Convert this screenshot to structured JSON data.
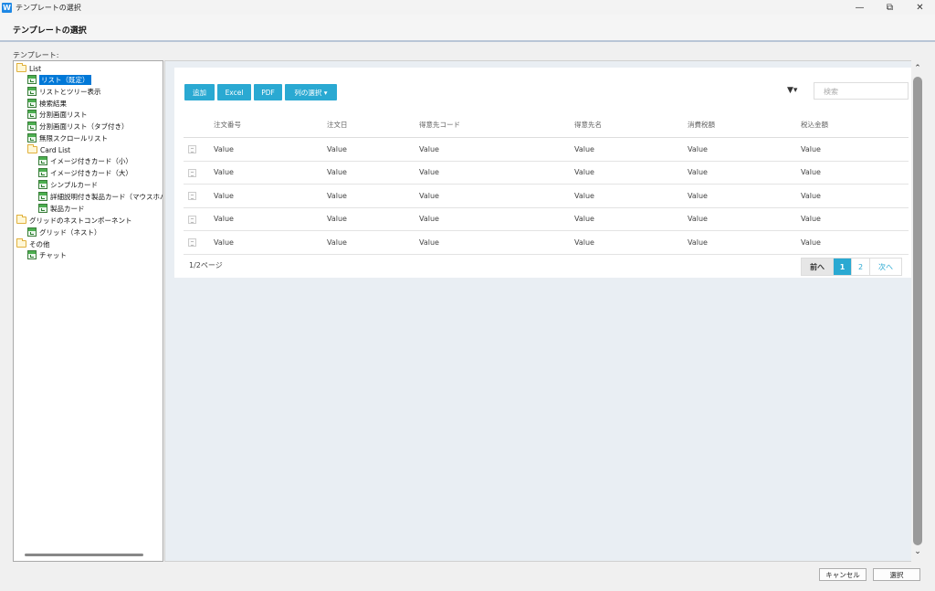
{
  "window": {
    "title": "テンプレートの選択",
    "app_icon": "W",
    "controls": [
      "—",
      "⧉",
      "✕"
    ]
  },
  "header": {
    "title": "テンプレートの選択"
  },
  "template_label": "テンプレート:",
  "tree": {
    "items": [
      {
        "label": "List",
        "type": "folder"
      },
      {
        "label": "リスト（既定）",
        "type": "page",
        "selected": true
      },
      {
        "label": "リストとツリー表示",
        "type": "page"
      },
      {
        "label": "検索結果",
        "type": "page"
      },
      {
        "label": "分割画面リスト",
        "type": "page"
      },
      {
        "label": "分割画面リスト（タブ付き）",
        "type": "page"
      },
      {
        "label": "無限スクロールリスト",
        "type": "page"
      },
      {
        "label": "Card List",
        "type": "folder"
      },
      {
        "label": "イメージ付きカード（小）",
        "type": "page"
      },
      {
        "label": "イメージ付きカード（大）",
        "type": "page"
      },
      {
        "label": "シンプルカード",
        "type": "page"
      },
      {
        "label": "詳細説明付き製品カード（マウスホバー",
        "type": "page"
      },
      {
        "label": "製品カード",
        "type": "page"
      },
      {
        "label": "グリッドのネストコンポーネント",
        "type": "folder"
      },
      {
        "label": "グリッド（ネスト）",
        "type": "page"
      },
      {
        "label": "その他",
        "type": "folder"
      },
      {
        "label": "チャット",
        "type": "page"
      }
    ]
  },
  "preview": {
    "toolbar": {
      "add_label": "追加",
      "excel_label": "Excel",
      "pdf_label": "PDF",
      "columns_label": "列の選択 ▾",
      "filter_icon": "▼▾",
      "search_placeholder": "検索"
    },
    "grid": {
      "headers": [
        "注文番号",
        "注文日",
        "得意先コード",
        "得意先名",
        "消費税額",
        "税込金額"
      ],
      "rows": [
        [
          "Value",
          "Value",
          "Value",
          "Value",
          "Value",
          "Value"
        ],
        [
          "Value",
          "Value",
          "Value",
          "Value",
          "Value",
          "Value"
        ],
        [
          "Value",
          "Value",
          "Value",
          "Value",
          "Value",
          "Value"
        ],
        [
          "Value",
          "Value",
          "Value",
          "Value",
          "Value",
          "Value"
        ],
        [
          "Value",
          "Value",
          "Value",
          "Value",
          "Value",
          "Value"
        ]
      ]
    },
    "pager": {
      "info": "1/2ページ",
      "prev": "前へ",
      "page1": "1",
      "page2": "2",
      "next": "次へ"
    }
  },
  "scrollbar": {
    "up": "⌃",
    "down": "⌄"
  },
  "footer": {
    "cancel_label": "キャンセル",
    "select_label": "選択"
  }
}
